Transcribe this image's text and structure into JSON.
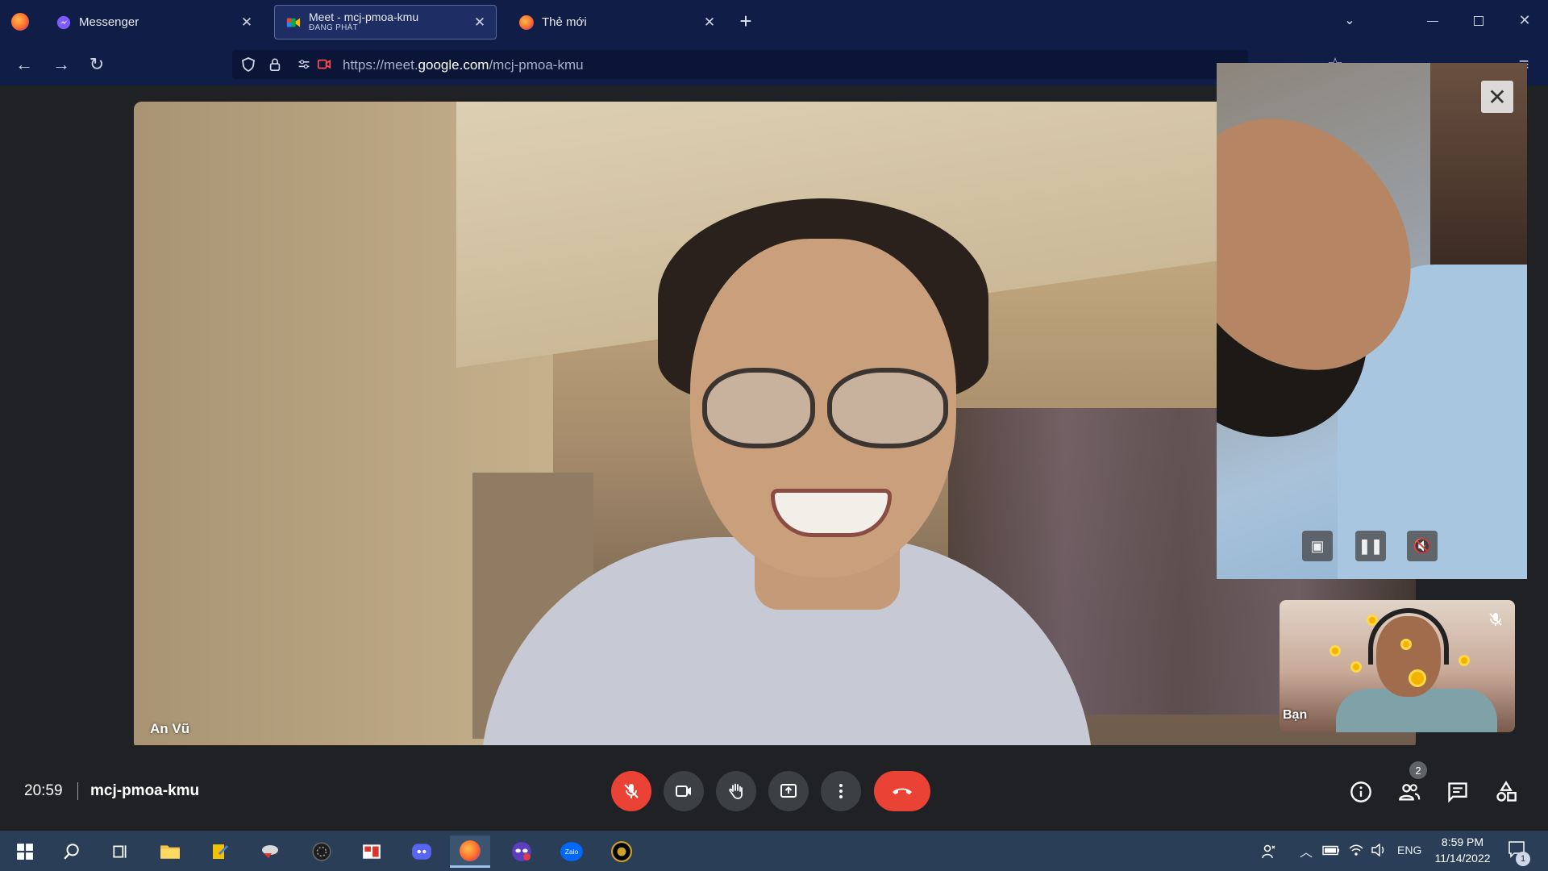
{
  "browser": {
    "tabs": [
      {
        "title": "Messenger",
        "icon": "messenger-icon"
      },
      {
        "title": "Meet - mcj-pmoa-kmu",
        "subtitle": "ĐANG PHÁT",
        "icon": "google-meet-icon",
        "active": true
      },
      {
        "title": "Thẻ mới",
        "icon": "firefox-icon"
      }
    ],
    "url_prefix": "https://meet.",
    "url_domain": "google.com",
    "url_path": "/mcj-pmoa-kmu"
  },
  "meet": {
    "main_participant": "An Vũ",
    "self_label": "Bạn",
    "time": "20:59",
    "meeting_code": "mcj-pmoa-kmu",
    "participant_count": "2",
    "colors": {
      "leave": "#ea4335",
      "control_bg": "#3c4043",
      "background": "#202124"
    }
  },
  "taskbar": {
    "language": "ENG",
    "time": "8:59 PM",
    "date": "11/14/2022",
    "notification_count": "1",
    "apps": [
      "windows-start-icon",
      "search-icon",
      "task-view-icon",
      "file-explorer-icon",
      "app-icon",
      "app-icon",
      "app-icon",
      "app-icon",
      "discord-icon",
      "firefox-icon",
      "app-icon",
      "zalo-icon",
      "app-icon"
    ]
  }
}
